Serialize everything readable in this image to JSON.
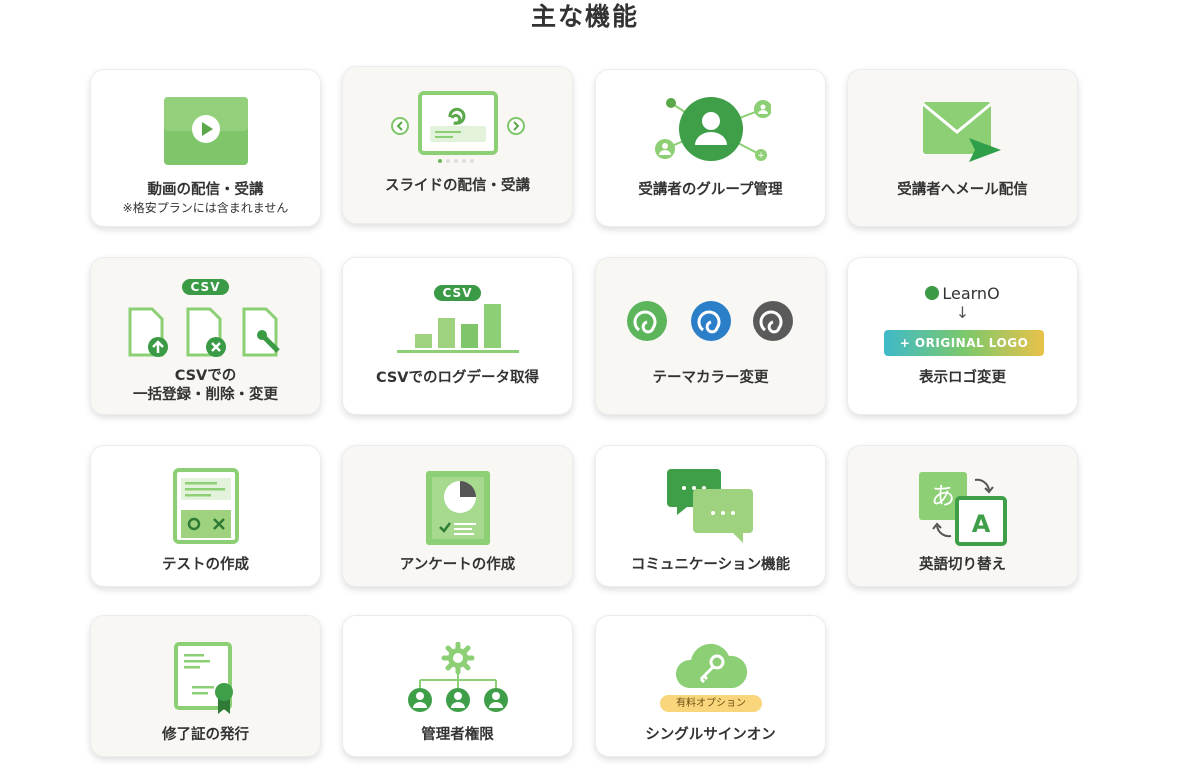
{
  "page": {
    "title": "主な機能"
  },
  "features": [
    {
      "label": "動画の配信・受講",
      "note": "※格安プランには含まれません",
      "icon": "video-play-icon"
    },
    {
      "label": "スライドの配信・受講",
      "icon": "slide-presentation-icon"
    },
    {
      "label": "受講者のグループ管理",
      "icon": "user-group-network-icon"
    },
    {
      "label": "受講者へメール配信",
      "icon": "mail-send-icon"
    },
    {
      "label_line1": "CSVでの",
      "label_line2": "一括登録・削除・変更",
      "badge": "CSV",
      "icon": "csv-bulk-files-icon"
    },
    {
      "label": "CSVでのログデータ取得",
      "badge": "CSV",
      "icon": "bar-chart-icon"
    },
    {
      "label": "テーマカラー変更",
      "icon": "theme-color-swirls-icon"
    },
    {
      "label": "表示ロゴ変更",
      "logo_text": "LearnO",
      "arrow": "↓",
      "original_logo": "+ ORIGINAL LOGO",
      "icon": "logo-change-icon"
    },
    {
      "label": "テストの作成",
      "icon": "test-sheet-icon"
    },
    {
      "label": "アンケートの作成",
      "icon": "survey-pie-icon"
    },
    {
      "label": "コミュニケーション機能",
      "icon": "chat-bubbles-icon"
    },
    {
      "label": "英語切り替え",
      "icon": "language-switch-icon"
    },
    {
      "label": "修了証の発行",
      "icon": "certificate-icon"
    },
    {
      "label": "管理者権限",
      "icon": "admin-hierarchy-icon"
    },
    {
      "label": "シングルサインオン",
      "option_badge": "有料オプション",
      "icon": "cloud-key-icon"
    }
  ],
  "colors": {
    "green": "#5db55b",
    "light_green": "#9fd27f",
    "dark_green": "#3a9a45",
    "blue": "#2b7fc9",
    "gray": "#5a5a5a",
    "beige_card": "#f8f7f4"
  }
}
